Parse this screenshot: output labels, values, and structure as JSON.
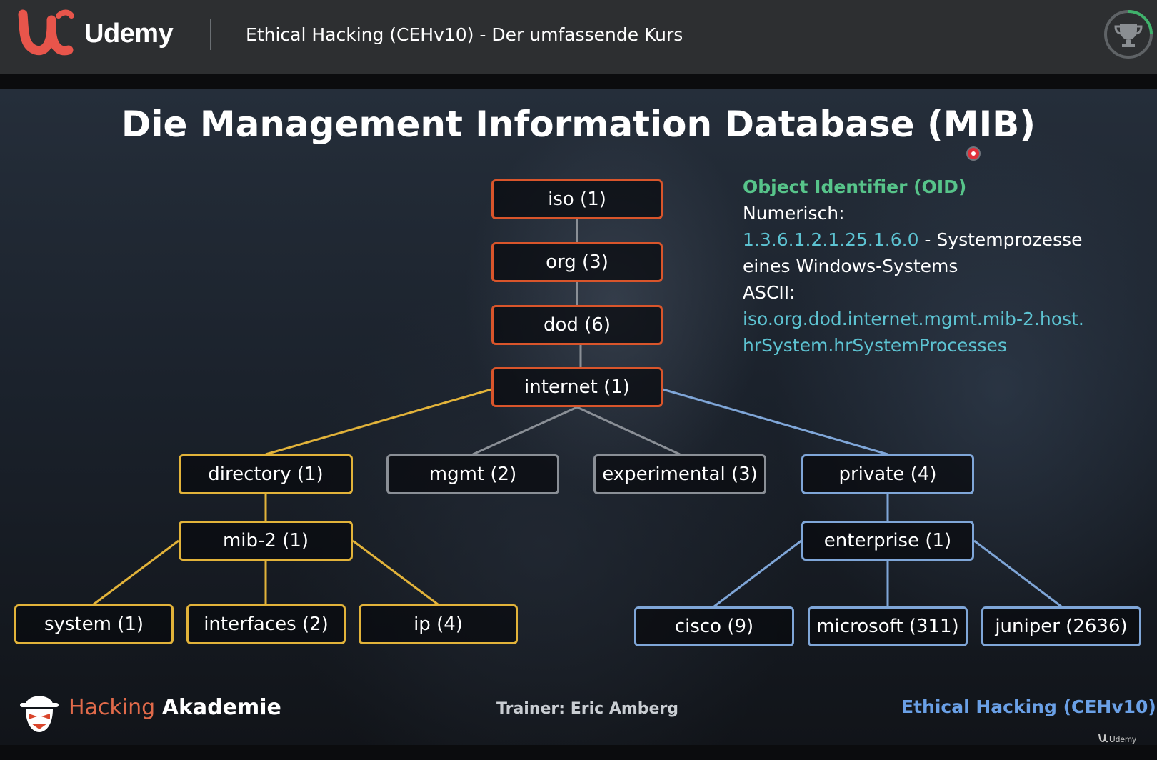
{
  "header": {
    "brand": "Udemy",
    "course_title": "Ethical Hacking (CEHv10) - Der umfassende Kurs"
  },
  "slide": {
    "title": "Die Management Information Database (MIB)",
    "tree": {
      "iso": "iso (1)",
      "org": "org (3)",
      "dod": "dod (6)",
      "internet": "internet (1)",
      "directory": "directory (1)",
      "mgmt": "mgmt (2)",
      "experimental": "experimental (3)",
      "private": "private (4)",
      "mib2": "mib-2 (1)",
      "enterprise": "enterprise (1)",
      "system": "system (1)",
      "interfaces": "interfaces (2)",
      "ip": "ip (4)",
      "cisco": "cisco (9)",
      "microsoft": "microsoft (311)",
      "juniper": "juniper (2636)"
    },
    "oid": {
      "heading": "Object Identifier (OID)",
      "numeric_label": "Numerisch:",
      "numeric_value": "1.3.6.1.2.1.25.1.6.0",
      "numeric_sep": " - ",
      "numeric_desc_1": "Systemprozesse",
      "numeric_desc_2": "eines Windows-Systems",
      "ascii_label": "ASCII:",
      "ascii_value_1": "iso.org.dod.internet.mgmt.mib-2.host.",
      "ascii_value_2": "hrSystem.hrSystemProcesses"
    },
    "footer": {
      "brand_part1": "Hacking",
      "brand_part2": "Akademie",
      "trainer": "Trainer: Eric Amberg",
      "course": "Ethical Hacking (CEHv10)",
      "watermark": "Udemy"
    }
  },
  "colors": {
    "red_node": "#d9552b",
    "yellow_node": "#e2b33a",
    "gray_node": "#8a8f96",
    "blue_node": "#7fa6d8",
    "oid_heading": "#57c48a",
    "oid_value": "#5dc3d2",
    "udemy_red": "#e8554b"
  },
  "icons": {
    "udemy_logo": "udemy-u-logo",
    "progress": "trophy-icon",
    "hacker_logo": "hacker-mask-icon"
  }
}
